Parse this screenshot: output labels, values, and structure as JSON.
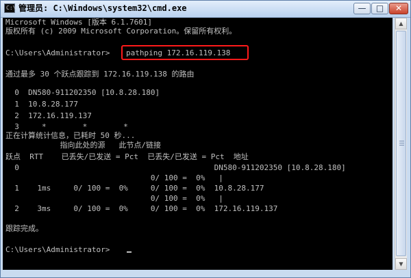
{
  "window": {
    "title": "管理员: C:\\Windows\\system32\\cmd.exe",
    "icon_label": "C:\\",
    "icons": {
      "app": "cmd-app-icon",
      "minimize": "minimize-icon",
      "maximize": "maximize-icon",
      "close": "close-icon"
    },
    "buttons": {
      "minimize": "—",
      "maximize": "□",
      "close": "✕"
    }
  },
  "console": {
    "lines": [
      "Microsoft Windows [版本 6.1.7601]",
      "版权所有 (c) 2009 Microsoft Corporation。保留所有权利。",
      "",
      "C:\\Users\\Administrator>",
      "",
      "通过最多 30 个跃点跟踪到 172.16.119.138 的路由",
      "",
      "  0  DN580-911202350 [10.8.28.180]",
      "  1  10.8.28.177",
      "  2  172.16.119.137",
      "  3     *        *        *",
      "正在计算统计信息，已耗时 50 秒...",
      "            指向此处的源   此节点/链接",
      "跃点  RTT    已丢失/已发送 = Pct  已丢失/已发送 = Pct  地址",
      "  0                                           DN580-911202350 [10.8.28.180]",
      "                                0/ 100 =  0%   |",
      "  1    1ms     0/ 100 =  0%     0/ 100 =  0%  10.8.28.177",
      "                                0/ 100 =  0%   |",
      "  2    3ms     0/ 100 =  0%     0/ 100 =  0%  172.16.119.137",
      "",
      "跟踪完成。",
      "",
      "C:\\Users\\Administrator>"
    ],
    "command": "pathping 172.16.119.138"
  },
  "scrollbar": {
    "up": "▲",
    "down": "▼",
    "icons": {
      "up": "scroll-up-arrow-icon",
      "down": "scroll-down-arrow-icon"
    }
  }
}
